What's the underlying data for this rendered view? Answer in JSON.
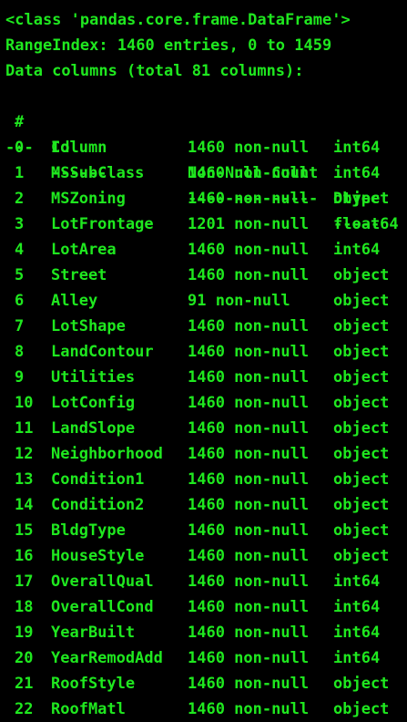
{
  "colors": {
    "background": "#000000",
    "text": "#1fe81f"
  },
  "output": {
    "class_line": "<class 'pandas.core.frame.DataFrame'>",
    "range_index": "RangeIndex: 1460 entries, 0 to 1459",
    "data_columns": "Data columns (total 81 columns):"
  },
  "header": {
    "idx": "#",
    "column": "Column",
    "non_null": "Non-Null Count",
    "dtype": "Dtype"
  },
  "separator": {
    "idx": "---",
    "column": "------",
    "non_null": "--------------",
    "dtype": "-----"
  },
  "rows": [
    {
      "idx": "0",
      "column": "Id",
      "non_null": "1460 non-null",
      "dtype": "int64"
    },
    {
      "idx": "1",
      "column": "MSSubClass",
      "non_null": "1460 non-null",
      "dtype": "int64"
    },
    {
      "idx": "2",
      "column": "MSZoning",
      "non_null": "1460 non-null",
      "dtype": "object"
    },
    {
      "idx": "3",
      "column": "LotFrontage",
      "non_null": "1201 non-null",
      "dtype": "float64"
    },
    {
      "idx": "4",
      "column": "LotArea",
      "non_null": "1460 non-null",
      "dtype": "int64"
    },
    {
      "idx": "5",
      "column": "Street",
      "non_null": "1460 non-null",
      "dtype": "object"
    },
    {
      "idx": "6",
      "column": "Alley",
      "non_null": "91 non-null",
      "dtype": "object"
    },
    {
      "idx": "7",
      "column": "LotShape",
      "non_null": "1460 non-null",
      "dtype": "object"
    },
    {
      "idx": "8",
      "column": "LandContour",
      "non_null": "1460 non-null",
      "dtype": "object"
    },
    {
      "idx": "9",
      "column": "Utilities",
      "non_null": "1460 non-null",
      "dtype": "object"
    },
    {
      "idx": "10",
      "column": "LotConfig",
      "non_null": "1460 non-null",
      "dtype": "object"
    },
    {
      "idx": "11",
      "column": "LandSlope",
      "non_null": "1460 non-null",
      "dtype": "object"
    },
    {
      "idx": "12",
      "column": "Neighborhood",
      "non_null": "1460 non-null",
      "dtype": "object"
    },
    {
      "idx": "13",
      "column": "Condition1",
      "non_null": "1460 non-null",
      "dtype": "object"
    },
    {
      "idx": "14",
      "column": "Condition2",
      "non_null": "1460 non-null",
      "dtype": "object"
    },
    {
      "idx": "15",
      "column": "BldgType",
      "non_null": "1460 non-null",
      "dtype": "object"
    },
    {
      "idx": "16",
      "column": "HouseStyle",
      "non_null": "1460 non-null",
      "dtype": "object"
    },
    {
      "idx": "17",
      "column": "OverallQual",
      "non_null": "1460 non-null",
      "dtype": "int64"
    },
    {
      "idx": "18",
      "column": "OverallCond",
      "non_null": "1460 non-null",
      "dtype": "int64"
    },
    {
      "idx": "19",
      "column": "YearBuilt",
      "non_null": "1460 non-null",
      "dtype": "int64"
    },
    {
      "idx": "20",
      "column": "YearRemodAdd",
      "non_null": "1460 non-null",
      "dtype": "int64"
    },
    {
      "idx": "21",
      "column": "RoofStyle",
      "non_null": "1460 non-null",
      "dtype": "object"
    },
    {
      "idx": "22",
      "column": "RoofMatl",
      "non_null": "1460 non-null",
      "dtype": "object"
    }
  ]
}
